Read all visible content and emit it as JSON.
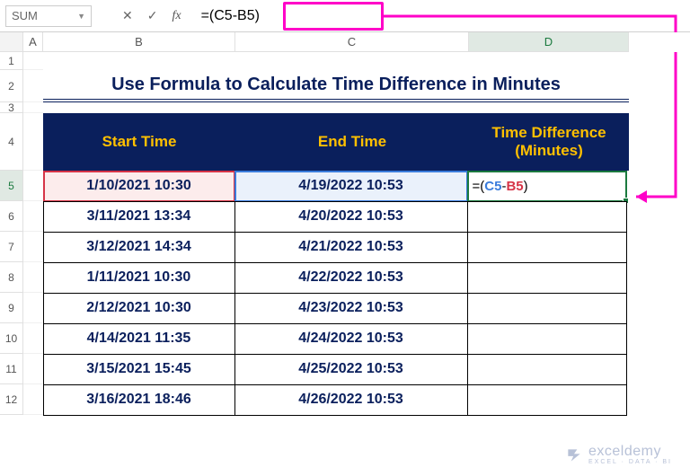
{
  "namebox": "SUM",
  "formula_bar": "=(C5-B5)",
  "columns": {
    "a": "A",
    "b": "B",
    "c": "C",
    "d": "D"
  },
  "row_nums": [
    "1",
    "2",
    "3",
    "4",
    "5",
    "6",
    "7",
    "8",
    "9",
    "10",
    "11",
    "12"
  ],
  "title": "Use Formula to Calculate Time Difference in Minutes",
  "headers": {
    "b": "Start Time",
    "c": "End Time",
    "d": "Time Difference (Minutes)"
  },
  "data": [
    {
      "b": "1/10/2021 10:30",
      "c": "4/19/2022 10:53"
    },
    {
      "b": "3/11/2021 13:34",
      "c": "4/20/2022 10:53"
    },
    {
      "b": "3/12/2021 14:34",
      "c": "4/21/2022 10:53"
    },
    {
      "b": "1/11/2021 10:30",
      "c": "4/22/2022 10:53"
    },
    {
      "b": "2/12/2021 10:30",
      "c": "4/23/2022 10:53"
    },
    {
      "b": "4/14/2021 11:35",
      "c": "4/24/2022 10:53"
    },
    {
      "b": "3/15/2021 15:45",
      "c": "4/25/2022 10:53"
    },
    {
      "b": "3/16/2021 18:46",
      "c": "4/26/2022 10:53"
    }
  ],
  "editing_cell": {
    "eq": "=",
    "open": "(",
    "c5": "C5",
    "minus": "-",
    "b5": "B5",
    "close": ")"
  },
  "watermark": {
    "main": "exceldemy",
    "sub": "EXCEL · DATA · BI"
  }
}
